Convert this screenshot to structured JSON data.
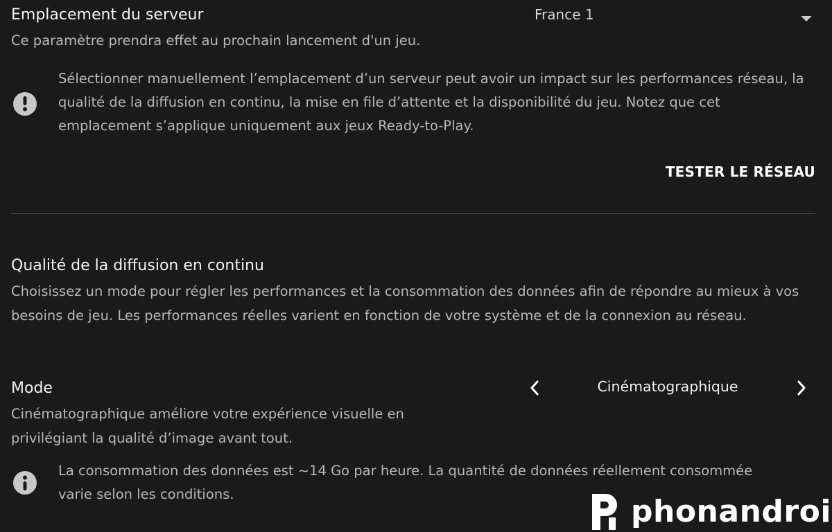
{
  "server_location": {
    "title": "Emplacement du serveur",
    "description": "Ce paramètre prendra effet au prochain lancement d'un jeu.",
    "selected": "France 1",
    "warning": "Sélectionner manuellement l’emplacement d’un serveur peut avoir un impact sur les performances réseau, la qualité de la diffusion en continu, la mise en file d’attente et la disponibilité du jeu. Notez que cet emplacement s’applique uniquement aux jeux Ready-to-Play.",
    "test_button": "TESTER LE RÉSEAU"
  },
  "streaming_quality": {
    "title": "Qualité de la diffusion en continu",
    "description": "Choisissez un mode pour régler les performances et la consommation des données afin de répondre au mieux à vos besoins de jeu. Les performances réelles varient en fonction de votre système et de la connexion au réseau."
  },
  "mode": {
    "title": "Mode",
    "value": "Cinématographique",
    "description": "Cinématographique améliore votre expérience visuelle en privilégiant la qualité d’image avant tout.",
    "info": "La consommation des données est ~14 Go par heure. La quantité de données réellement consommée varie selon les conditions."
  },
  "watermark": {
    "text": "phonandroid"
  },
  "icons": {
    "warning": "exclamation-circle-icon",
    "info": "info-circle-icon",
    "dropdown": "caret-down-icon",
    "prev": "chevron-left-icon",
    "next": "chevron-right-icon"
  },
  "colors": {
    "background": "#1a1a1a",
    "title": "#f2f2f2",
    "text_secondary": "#b8b8b8",
    "icon": "#c8c8c8",
    "divider": "#4a4a4a"
  }
}
